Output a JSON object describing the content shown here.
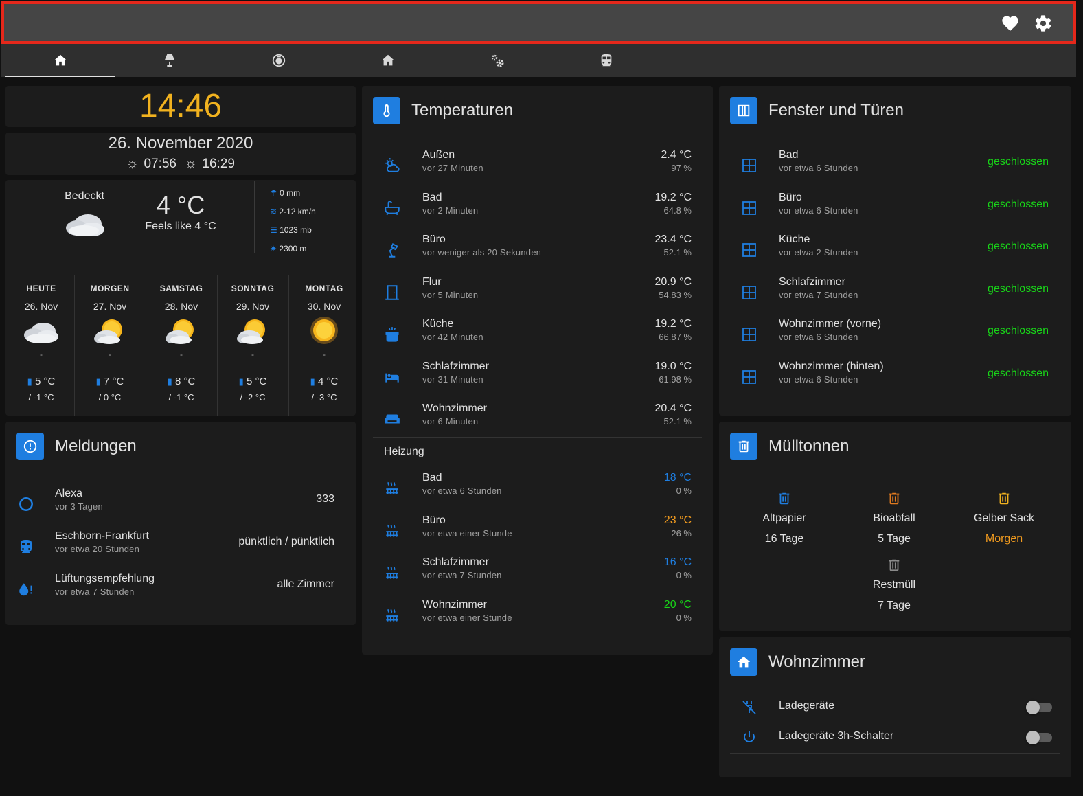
{
  "header": {
    "icons": [
      "heart-icon",
      "gear-icon"
    ]
  },
  "tabs": [
    {
      "icon": "home-icon",
      "active": true
    },
    {
      "icon": "lamp-icon",
      "active": false
    },
    {
      "icon": "vacuum-icon",
      "active": false
    },
    {
      "icon": "home-icon",
      "active": false
    },
    {
      "icon": "gears-icon",
      "active": false
    },
    {
      "icon": "train-icon",
      "active": false
    }
  ],
  "clock": {
    "time": "14:46",
    "date": "26. November 2020",
    "sunrise": "07:56",
    "sunset": "16:29"
  },
  "weather": {
    "condition": "Bedeckt",
    "temperature": "4 °C",
    "feels_like": "Feels like 4 °C",
    "precipitation": "0 mm",
    "wind": "2-12 km/h",
    "pressure": "1023 mb",
    "visibility": "2300 m",
    "forecast": [
      {
        "day": "HEUTE",
        "date": "26. Nov",
        "icon": "cloudy-icon",
        "precip": "-",
        "high": "5 °C",
        "low": "/ -1 °C"
      },
      {
        "day": "MORGEN",
        "date": "27. Nov",
        "icon": "partly-cloudy-icon",
        "precip": "-",
        "high": "7 °C",
        "low": "/ 0 °C"
      },
      {
        "day": "SAMSTAG",
        "date": "28. Nov",
        "icon": "partly-cloudy-icon",
        "precip": "-",
        "high": "8 °C",
        "low": "/ -1 °C"
      },
      {
        "day": "SONNTAG",
        "date": "29. Nov",
        "icon": "partly-cloudy-icon",
        "precip": "-",
        "high": "5 °C",
        "low": "/ -2 °C"
      },
      {
        "day": "MONTAG",
        "date": "30. Nov",
        "icon": "sunny-icon",
        "precip": "-",
        "high": "4 °C",
        "low": "/ -3 °C"
      }
    ]
  },
  "meldungen": {
    "title": "Meldungen",
    "items": [
      {
        "icon": "alexa-icon",
        "name": "Alexa",
        "sub": "vor 3 Tagen",
        "value": "333"
      },
      {
        "icon": "train-icon",
        "name": "Eschborn-Frankfurt",
        "sub": "vor etwa 20 Stunden",
        "value": "pünktlich / pünktlich"
      },
      {
        "icon": "water-alert-icon",
        "name": "Lüftungsempfehlung",
        "sub": "vor etwa 7 Stunden",
        "value": "alle Zimmer"
      }
    ]
  },
  "temperaturen": {
    "title": "Temperaturen",
    "rooms": [
      {
        "icon": "weather-icon",
        "name": "Außen",
        "sub": "vor 27 Minuten",
        "temp": "2.4 °C",
        "hum": "97 %"
      },
      {
        "icon": "bathtub-icon",
        "name": "Bad",
        "sub": "vor 2 Minuten",
        "temp": "19.2 °C",
        "hum": "64.8 %"
      },
      {
        "icon": "desk-lamp-icon",
        "name": "Büro",
        "sub": "vor weniger als 20 Sekunden",
        "temp": "23.4 °C",
        "hum": "52.1 %"
      },
      {
        "icon": "door-icon",
        "name": "Flur",
        "sub": "vor 5 Minuten",
        "temp": "20.9 °C",
        "hum": "54.83 %"
      },
      {
        "icon": "pot-icon",
        "name": "Küche",
        "sub": "vor 42 Minuten",
        "temp": "19.2 °C",
        "hum": "66.87 %"
      },
      {
        "icon": "bed-icon",
        "name": "Schlafzimmer",
        "sub": "vor 31 Minuten",
        "temp": "19.0 °C",
        "hum": "61.98 %"
      },
      {
        "icon": "sofa-icon",
        "name": "Wohnzimmer",
        "sub": "vor 6 Minuten",
        "temp": "20.4 °C",
        "hum": "52.1 %"
      }
    ],
    "heizung_label": "Heizung",
    "heizung": [
      {
        "icon": "radiator-icon",
        "name": "Bad",
        "sub": "vor etwa 6 Stunden",
        "temp": "18 °C",
        "pct": "0 %",
        "color": "#1f7ee0"
      },
      {
        "icon": "radiator-icon",
        "name": "Büro",
        "sub": "vor etwa einer Stunde",
        "temp": "23 °C",
        "pct": "26 %",
        "color": "#f19b1f"
      },
      {
        "icon": "radiator-icon",
        "name": "Schlafzimmer",
        "sub": "vor etwa 7 Stunden",
        "temp": "16 °C",
        "pct": "0 %",
        "color": "#1f7ee0"
      },
      {
        "icon": "radiator-icon",
        "name": "Wohnzimmer",
        "sub": "vor etwa einer Stunde",
        "temp": "20 °C",
        "pct": "0 %",
        "color": "#18d618"
      }
    ]
  },
  "fenster": {
    "title": "Fenster und Türen",
    "items": [
      {
        "name": "Bad",
        "sub": "vor etwa 6 Stunden",
        "state": "geschlossen"
      },
      {
        "name": "Büro",
        "sub": "vor etwa 6 Stunden",
        "state": "geschlossen"
      },
      {
        "name": "Küche",
        "sub": "vor etwa 2 Stunden",
        "state": "geschlossen"
      },
      {
        "name": "Schlafzimmer",
        "sub": "vor etwa 7 Stunden",
        "state": "geschlossen"
      },
      {
        "name": "Wohnzimmer (vorne)",
        "sub": "vor etwa 6 Stunden",
        "state": "geschlossen"
      },
      {
        "name": "Wohnzimmer (hinten)",
        "sub": "vor etwa 6 Stunden",
        "state": "geschlossen"
      }
    ],
    "state_color": "#18d618"
  },
  "muell": {
    "title": "Mülltonnen",
    "items": [
      {
        "name": "Altpapier",
        "days": "16 Tage",
        "icon_color": "#1f7ee0",
        "days_color": "#e1e1e1"
      },
      {
        "name": "Bioabfall",
        "days": "5 Tage",
        "icon_color": "#e07a1f",
        "days_color": "#e1e1e1"
      },
      {
        "name": "Gelber Sack",
        "days": "Morgen",
        "icon_color": "#f1b21f",
        "days_color": "#f19b1f"
      },
      {
        "name": "Restmüll",
        "days": "7 Tage",
        "icon_color": "#8a8a8a",
        "days_color": "#e1e1e1"
      }
    ]
  },
  "wohnzimmer": {
    "title": "Wohnzimmer",
    "switches": [
      {
        "icon": "power-plug-off-icon",
        "name": "Ladegeräte",
        "on": false
      },
      {
        "icon": "power-icon",
        "name": "Ladegeräte 3h-Schalter",
        "on": false
      }
    ]
  }
}
